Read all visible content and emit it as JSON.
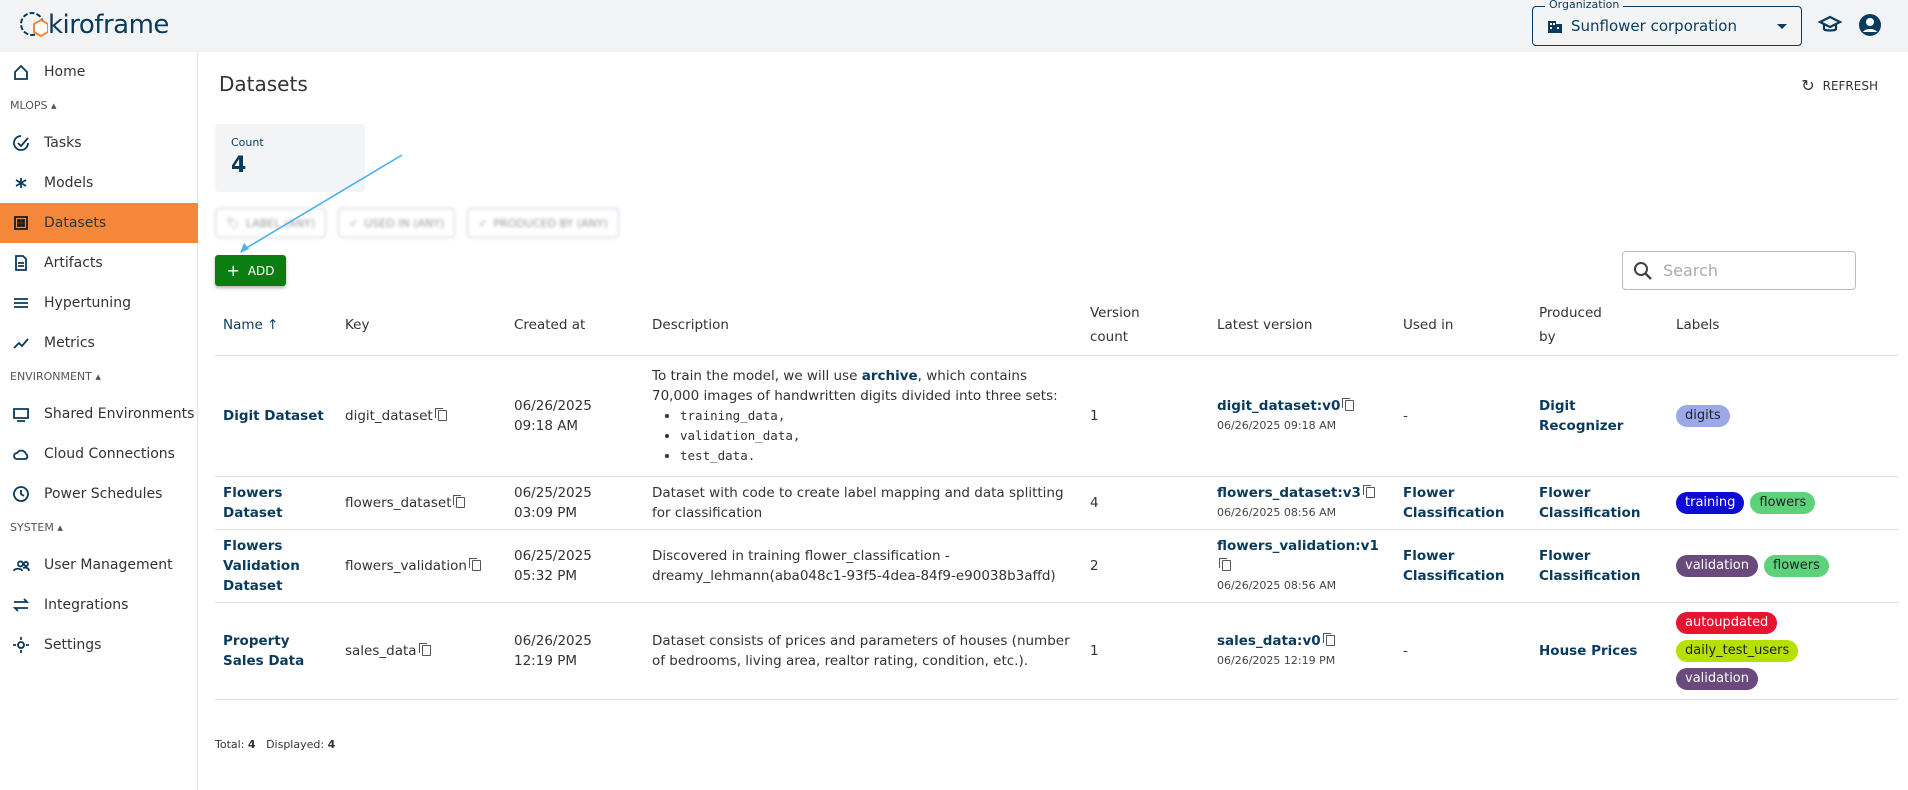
{
  "app": {
    "logo": "kiroframe"
  },
  "header": {
    "org_label": "Organization",
    "org_value": "Sunflower corporation"
  },
  "sidebar": {
    "home": "Home",
    "sections": [
      {
        "title": "MLOPS",
        "items": [
          "Tasks",
          "Models",
          "Datasets",
          "Artifacts",
          "Hypertuning",
          "Metrics"
        ]
      },
      {
        "title": "ENVIRONMENT",
        "items": [
          "Shared Environments",
          "Cloud Connections",
          "Power Schedules"
        ]
      },
      {
        "title": "SYSTEM",
        "items": [
          "User Management",
          "Integrations",
          "Settings"
        ]
      }
    ],
    "active": "Datasets"
  },
  "page": {
    "title": "Datasets",
    "refresh": "REFRESH",
    "count_label": "Count",
    "count_value": "4",
    "filters": [
      "LABEL (ANY)",
      "USED IN (ANY)",
      "PRODUCED BY (ANY)"
    ],
    "add": "ADD",
    "search_placeholder": "Search"
  },
  "table": {
    "headers": [
      "Name",
      "Key",
      "Created at",
      "Description",
      "Version count",
      "Latest version",
      "Used in",
      "Produced by",
      "Labels"
    ],
    "rows": [
      {
        "name": "Digit Dataset",
        "key": "digit_dataset",
        "created_date": "06/26/2025",
        "created_time": "09:18 AM",
        "desc_pre": "To train the model, we will use ",
        "desc_link": "archive",
        "desc_post": ", which contains 70,000 images of handwritten digits divided into three sets:",
        "desc_list": [
          "training_data,",
          "validation_data,",
          "test_data."
        ],
        "versions": "1",
        "latest": "digit_dataset:v0",
        "latest_date": "06/26/2025 09:18 AM",
        "used_in": "-",
        "produced_by": "Digit Recognizer",
        "labels": [
          {
            "text": "digits",
            "bg": "#9ba9e6",
            "fg": "#222"
          }
        ]
      },
      {
        "name": "Flowers Dataset",
        "key": "flowers_dataset",
        "created_date": "06/25/2025",
        "created_time": "03:09 PM",
        "desc": "Dataset with code to create label mapping and data splitting for classification",
        "versions": "4",
        "latest": "flowers_dataset:v3",
        "latest_date": "06/26/2025 08:56 AM",
        "used_in": "Flower Classification",
        "produced_by": "Flower Classification",
        "labels": [
          {
            "text": "training",
            "bg": "#0d0ad6",
            "fg": "#fff"
          },
          {
            "text": "flowers",
            "bg": "#5dd27a",
            "fg": "#222"
          }
        ]
      },
      {
        "name": "Flowers Validation Dataset",
        "key": "flowers_validation",
        "created_date": "06/25/2025",
        "created_time": "05:32 PM",
        "desc": "Discovered in training flower_classification - dreamy_lehmann(aba048c1-93f5-4dea-84f9-e90038b3affd)",
        "versions": "2",
        "latest": "flowers_validation:v1",
        "latest_date": "06/26/2025 08:56 AM",
        "used_in": "Flower Classification",
        "produced_by": "Flower Classification",
        "labels": [
          {
            "text": "validation",
            "bg": "#6a4a7c",
            "fg": "#fff"
          },
          {
            "text": "flowers",
            "bg": "#5dd27a",
            "fg": "#222"
          }
        ]
      },
      {
        "name": "Property Sales Data",
        "key": "sales_data",
        "created_date": "06/26/2025",
        "created_time": "12:19 PM",
        "desc": "Dataset consists of prices and parameters of houses (number of bedrooms, living area, realtor rating, condition, etc.).",
        "versions": "1",
        "latest": "sales_data:v0",
        "latest_date": "06/26/2025 12:19 PM",
        "used_in": "-",
        "produced_by": "House Prices",
        "labels": [
          {
            "text": "autoupdated",
            "bg": "#e8132e",
            "fg": "#fff"
          },
          {
            "text": "daily_test_users",
            "bg": "#b5e000",
            "fg": "#222"
          },
          {
            "text": "validation",
            "bg": "#6a4a7c",
            "fg": "#fff"
          }
        ]
      }
    ]
  },
  "footer": {
    "total_label": "Total:",
    "total": "4",
    "displayed_label": "Displayed:",
    "displayed": "4"
  },
  "colors": {
    "accent": "#f5873a",
    "primary": "#0a3b5c",
    "add": "#0a7d12"
  }
}
